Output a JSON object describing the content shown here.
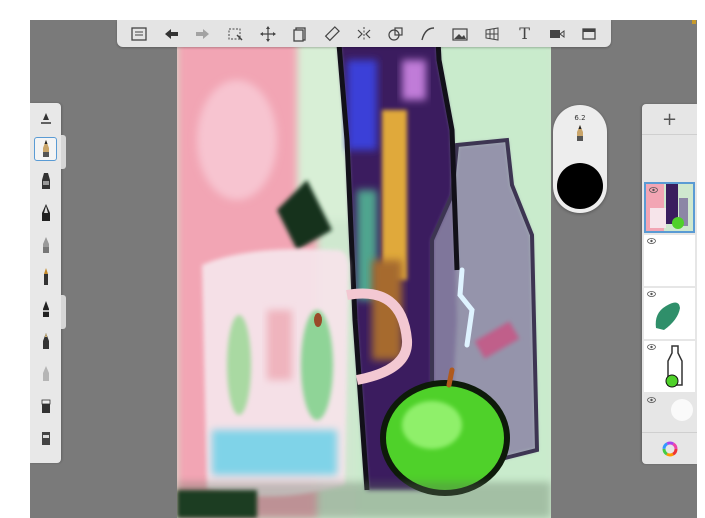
{
  "toolbar": {
    "items": [
      "menu-icon",
      "undo-icon",
      "redo-icon",
      "selection-icon",
      "transform-icon",
      "layer-copy-icon",
      "ruler-icon",
      "symmetry-icon",
      "shape-icon",
      "curve-icon",
      "image-import-icon",
      "perspective-icon",
      "text-icon",
      "video-icon",
      "fullscreen-icon"
    ],
    "text_label": "T"
  },
  "brush_size": {
    "value": "6.2",
    "color": "#000000"
  },
  "brush_library": {
    "items": [
      "pencil-brush-icon",
      "marker-brush-icon",
      "pen-brush-icon",
      "airbrush-icon",
      "paintbrush-icon",
      "ink-pen-icon",
      "fineliner-icon",
      "smudge-icon",
      "eraser-icon",
      "bucket-icon"
    ],
    "selected_index": 0
  },
  "layers": {
    "add_label": "+",
    "selected_index": 0
  },
  "colors": {
    "app_bg": "#7a7a7a",
    "panel": "#e6e6e6",
    "accent": "#5a9bd4"
  }
}
